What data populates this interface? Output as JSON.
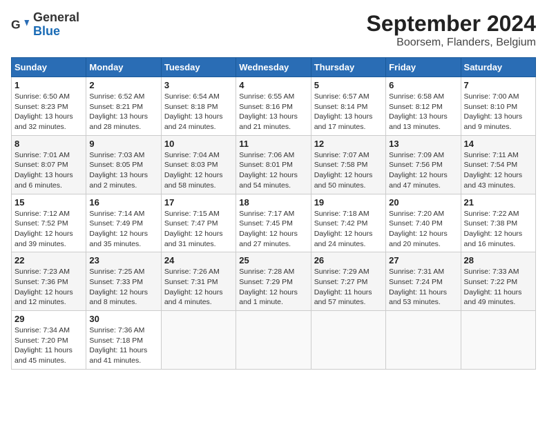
{
  "header": {
    "logo_general": "General",
    "logo_blue": "Blue",
    "title": "September 2024",
    "subtitle": "Boorsem, Flanders, Belgium"
  },
  "columns": [
    "Sunday",
    "Monday",
    "Tuesday",
    "Wednesday",
    "Thursday",
    "Friday",
    "Saturday"
  ],
  "weeks": [
    [
      {
        "day": "1",
        "sunrise": "Sunrise: 6:50 AM",
        "sunset": "Sunset: 8:23 PM",
        "daylight": "Daylight: 13 hours and 32 minutes."
      },
      {
        "day": "2",
        "sunrise": "Sunrise: 6:52 AM",
        "sunset": "Sunset: 8:21 PM",
        "daylight": "Daylight: 13 hours and 28 minutes."
      },
      {
        "day": "3",
        "sunrise": "Sunrise: 6:54 AM",
        "sunset": "Sunset: 8:18 PM",
        "daylight": "Daylight: 13 hours and 24 minutes."
      },
      {
        "day": "4",
        "sunrise": "Sunrise: 6:55 AM",
        "sunset": "Sunset: 8:16 PM",
        "daylight": "Daylight: 13 hours and 21 minutes."
      },
      {
        "day": "5",
        "sunrise": "Sunrise: 6:57 AM",
        "sunset": "Sunset: 8:14 PM",
        "daylight": "Daylight: 13 hours and 17 minutes."
      },
      {
        "day": "6",
        "sunrise": "Sunrise: 6:58 AM",
        "sunset": "Sunset: 8:12 PM",
        "daylight": "Daylight: 13 hours and 13 minutes."
      },
      {
        "day": "7",
        "sunrise": "Sunrise: 7:00 AM",
        "sunset": "Sunset: 8:10 PM",
        "daylight": "Daylight: 13 hours and 9 minutes."
      }
    ],
    [
      {
        "day": "8",
        "sunrise": "Sunrise: 7:01 AM",
        "sunset": "Sunset: 8:07 PM",
        "daylight": "Daylight: 13 hours and 6 minutes."
      },
      {
        "day": "9",
        "sunrise": "Sunrise: 7:03 AM",
        "sunset": "Sunset: 8:05 PM",
        "daylight": "Daylight: 13 hours and 2 minutes."
      },
      {
        "day": "10",
        "sunrise": "Sunrise: 7:04 AM",
        "sunset": "Sunset: 8:03 PM",
        "daylight": "Daylight: 12 hours and 58 minutes."
      },
      {
        "day": "11",
        "sunrise": "Sunrise: 7:06 AM",
        "sunset": "Sunset: 8:01 PM",
        "daylight": "Daylight: 12 hours and 54 minutes."
      },
      {
        "day": "12",
        "sunrise": "Sunrise: 7:07 AM",
        "sunset": "Sunset: 7:58 PM",
        "daylight": "Daylight: 12 hours and 50 minutes."
      },
      {
        "day": "13",
        "sunrise": "Sunrise: 7:09 AM",
        "sunset": "Sunset: 7:56 PM",
        "daylight": "Daylight: 12 hours and 47 minutes."
      },
      {
        "day": "14",
        "sunrise": "Sunrise: 7:11 AM",
        "sunset": "Sunset: 7:54 PM",
        "daylight": "Daylight: 12 hours and 43 minutes."
      }
    ],
    [
      {
        "day": "15",
        "sunrise": "Sunrise: 7:12 AM",
        "sunset": "Sunset: 7:52 PM",
        "daylight": "Daylight: 12 hours and 39 minutes."
      },
      {
        "day": "16",
        "sunrise": "Sunrise: 7:14 AM",
        "sunset": "Sunset: 7:49 PM",
        "daylight": "Daylight: 12 hours and 35 minutes."
      },
      {
        "day": "17",
        "sunrise": "Sunrise: 7:15 AM",
        "sunset": "Sunset: 7:47 PM",
        "daylight": "Daylight: 12 hours and 31 minutes."
      },
      {
        "day": "18",
        "sunrise": "Sunrise: 7:17 AM",
        "sunset": "Sunset: 7:45 PM",
        "daylight": "Daylight: 12 hours and 27 minutes."
      },
      {
        "day": "19",
        "sunrise": "Sunrise: 7:18 AM",
        "sunset": "Sunset: 7:42 PM",
        "daylight": "Daylight: 12 hours and 24 minutes."
      },
      {
        "day": "20",
        "sunrise": "Sunrise: 7:20 AM",
        "sunset": "Sunset: 7:40 PM",
        "daylight": "Daylight: 12 hours and 20 minutes."
      },
      {
        "day": "21",
        "sunrise": "Sunrise: 7:22 AM",
        "sunset": "Sunset: 7:38 PM",
        "daylight": "Daylight: 12 hours and 16 minutes."
      }
    ],
    [
      {
        "day": "22",
        "sunrise": "Sunrise: 7:23 AM",
        "sunset": "Sunset: 7:36 PM",
        "daylight": "Daylight: 12 hours and 12 minutes."
      },
      {
        "day": "23",
        "sunrise": "Sunrise: 7:25 AM",
        "sunset": "Sunset: 7:33 PM",
        "daylight": "Daylight: 12 hours and 8 minutes."
      },
      {
        "day": "24",
        "sunrise": "Sunrise: 7:26 AM",
        "sunset": "Sunset: 7:31 PM",
        "daylight": "Daylight: 12 hours and 4 minutes."
      },
      {
        "day": "25",
        "sunrise": "Sunrise: 7:28 AM",
        "sunset": "Sunset: 7:29 PM",
        "daylight": "Daylight: 12 hours and 1 minute."
      },
      {
        "day": "26",
        "sunrise": "Sunrise: 7:29 AM",
        "sunset": "Sunset: 7:27 PM",
        "daylight": "Daylight: 11 hours and 57 minutes."
      },
      {
        "day": "27",
        "sunrise": "Sunrise: 7:31 AM",
        "sunset": "Sunset: 7:24 PM",
        "daylight": "Daylight: 11 hours and 53 minutes."
      },
      {
        "day": "28",
        "sunrise": "Sunrise: 7:33 AM",
        "sunset": "Sunset: 7:22 PM",
        "daylight": "Daylight: 11 hours and 49 minutes."
      }
    ],
    [
      {
        "day": "29",
        "sunrise": "Sunrise: 7:34 AM",
        "sunset": "Sunset: 7:20 PM",
        "daylight": "Daylight: 11 hours and 45 minutes."
      },
      {
        "day": "30",
        "sunrise": "Sunrise: 7:36 AM",
        "sunset": "Sunset: 7:18 PM",
        "daylight": "Daylight: 11 hours and 41 minutes."
      },
      null,
      null,
      null,
      null,
      null
    ]
  ]
}
